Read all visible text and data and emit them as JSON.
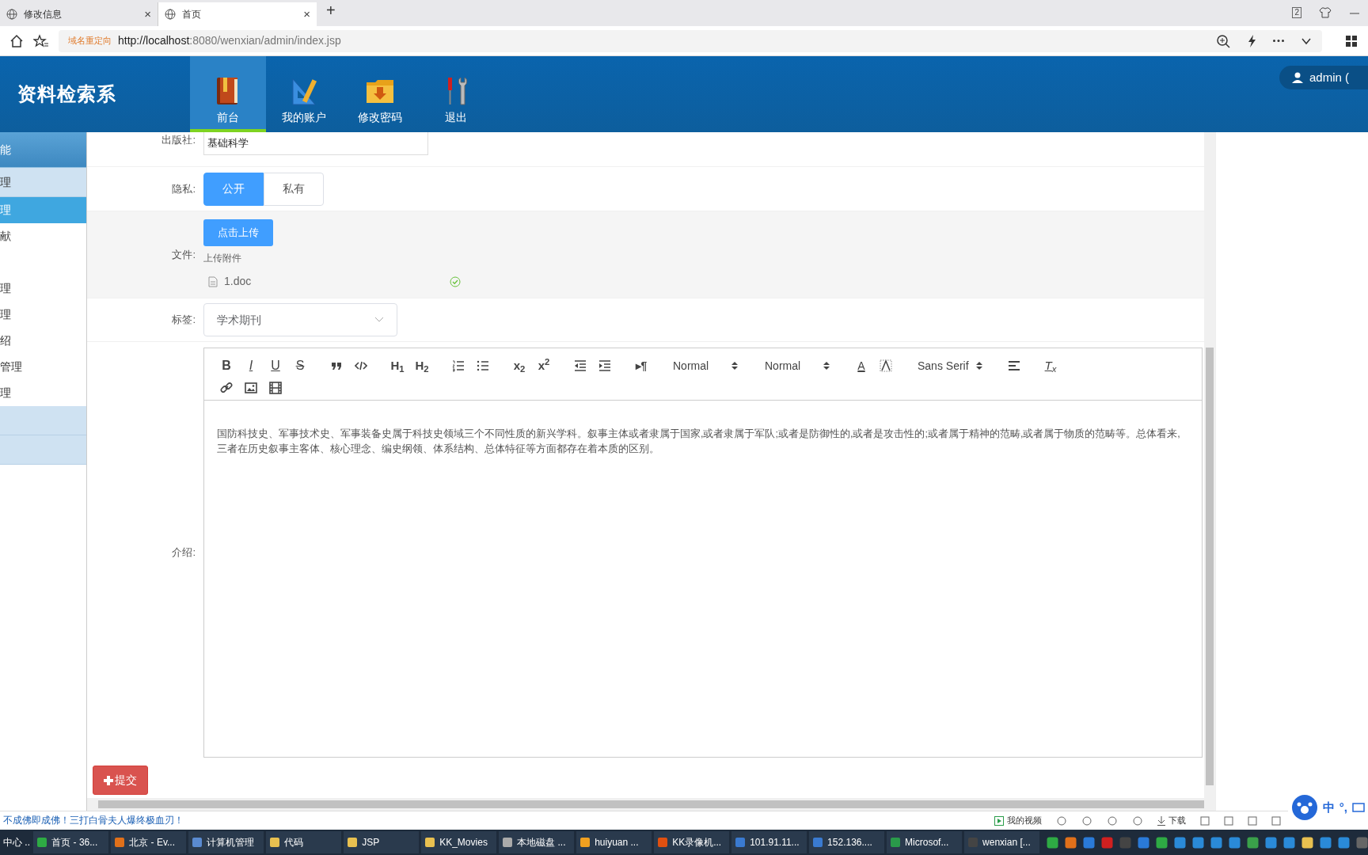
{
  "browser": {
    "tabs": [
      {
        "label": "修改信息",
        "close": "×",
        "selected": false
      },
      {
        "label": "首页",
        "close": "×",
        "selected": true
      }
    ],
    "new_tab": "+",
    "tab_count": "2",
    "redirect_note": "域名重定向",
    "url_host": "http://localhost",
    "url_rest": ":8080/wenxian/admin/index.jsp"
  },
  "header": {
    "title": "资料检索系",
    "nav": [
      {
        "label": "前台",
        "selected": true
      },
      {
        "label": "我的账户",
        "selected": false
      },
      {
        "label": "修改密码",
        "selected": false
      },
      {
        "label": "退出",
        "selected": false
      }
    ],
    "user": "admin",
    "user_suffix": "("
  },
  "sidebar": {
    "items": [
      {
        "label": "能",
        "kind": "heading"
      },
      {
        "label": "理",
        "kind": "group"
      },
      {
        "label": "理",
        "kind": "item",
        "selected": true
      },
      {
        "label": "献",
        "kind": "item",
        "selected": false
      },
      {
        "kind": "blank"
      },
      {
        "label": "理",
        "kind": "item",
        "selected": false
      },
      {
        "label": "理",
        "kind": "item",
        "selected": false
      },
      {
        "label": "绍",
        "kind": "item",
        "selected": false
      },
      {
        "label": "管理",
        "kind": "item",
        "selected": false
      },
      {
        "label": "理",
        "kind": "item",
        "selected": false
      },
      {
        "kind": "group"
      },
      {
        "kind": "group"
      }
    ]
  },
  "form": {
    "publisher": {
      "label": "出版社:",
      "value": "基础科学"
    },
    "privacy": {
      "label": "隐私:",
      "options": [
        {
          "label": "公开",
          "selected": true
        },
        {
          "label": "私有",
          "selected": false
        }
      ]
    },
    "file": {
      "label": "文件:",
      "button": "点击上传",
      "tip": "上传附件",
      "files": [
        {
          "name": "1.doc",
          "done": true
        }
      ]
    },
    "tag": {
      "label": "标签:",
      "value": "学术期刊"
    },
    "intro": {
      "label": "介绍:",
      "toolbar": [
        [
          {
            "kind": "bold",
            "label": "B"
          },
          {
            "kind": "italic",
            "label": "I"
          },
          {
            "kind": "underline",
            "label": "U"
          },
          {
            "kind": "strike",
            "label": "S"
          },
          {
            "kind": "quote"
          },
          {
            "kind": "code"
          },
          {
            "kind": "heading",
            "label": "H$_{1}$"
          },
          {
            "kind": "heading",
            "label": "H$_{2}$"
          },
          {
            "kind": "ordered"
          },
          {
            "kind": "bullet"
          },
          {
            "kind": "script",
            "label": "x$_{2}$"
          },
          {
            "kind": "script",
            "label": "x$^{2}$"
          },
          {
            "kind": "outdent"
          },
          {
            "kind": "indent"
          },
          {
            "kind": "direction",
            "label": "▸¶"
          },
          {
            "kind": "select",
            "label": "Normal"
          },
          {
            "kind": "select",
            "label": "Normal"
          },
          {
            "kind": "color",
            "label": "A"
          },
          {
            "kind": "background"
          },
          {
            "kind": "select",
            "label": "Sans Serif"
          },
          {
            "kind": "align"
          },
          {
            "kind": "clean",
            "label": "T$_{x}$"
          }
        ],
        [
          {
            "kind": "link"
          },
          {
            "kind": "image"
          },
          {
            "kind": "video"
          }
        ]
      ],
      "text": "国防科技史、军事技术史、军事装备史属于科技史领域三个不同性质的新兴学科。叙事主体或者隶属于国家,或者隶属于军队;或者是防御性的,或者是攻击性的;或者属于精神的范畴,或者属于物质的范畴等。总体看来,三者在历史叙事主客体、核心理念、编史纲领、体系结构、总体特征等方面都存在着本质的区别。"
    },
    "submit": "提交"
  },
  "status_bar": {
    "news": "不成佛即成佛！三打白骨夫人爆终极血刃！",
    "video": "我的视频",
    "download": "下载",
    "ime": [
      "中",
      "°,"
    ]
  },
  "taskbar": [
    "中心 ...",
    "首页 - 36...",
    "北京 - Ev...",
    "计算机管理",
    "代码",
    "JSP",
    "KK_Movies",
    "本地磁盘 ...",
    "huiyuan ...",
    "KK录像机...",
    "101.91.11...",
    "152.136....",
    "Microsof...",
    "wenxian [..."
  ]
}
